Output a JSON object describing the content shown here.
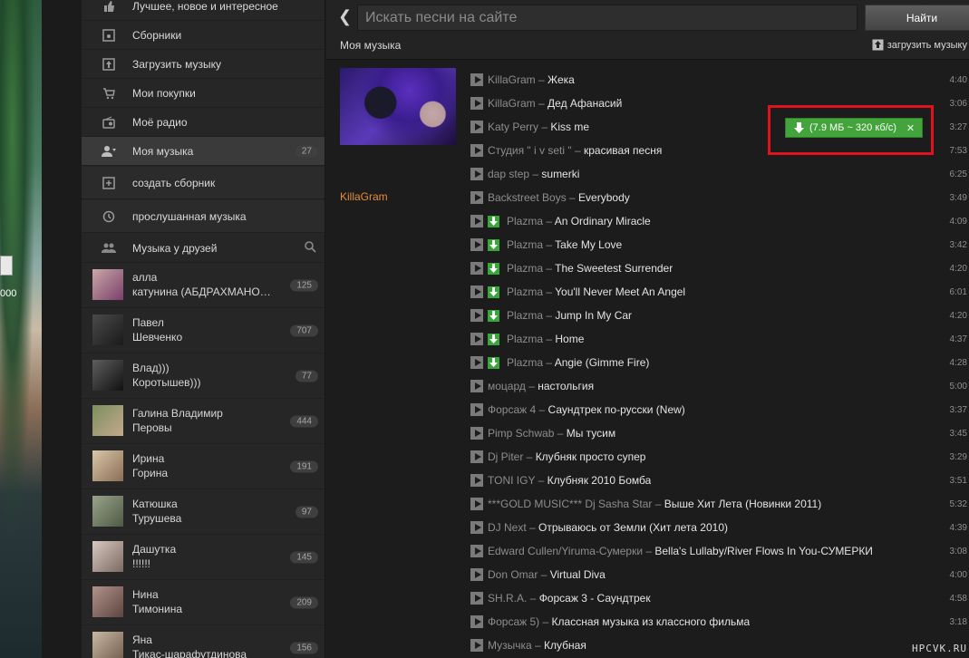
{
  "sidebar": {
    "nav": [
      {
        "label": "Лучшее, новое и интересное",
        "icon": "thumbs-up-icon"
      },
      {
        "label": "Сборники",
        "icon": "album-icon"
      },
      {
        "label": "Загрузить музыку",
        "icon": "upload-icon"
      },
      {
        "label": "Мои покупки",
        "icon": "cart-icon"
      },
      {
        "label": "Моё радио",
        "icon": "radio-icon"
      },
      {
        "label": "Моя музыка",
        "icon": "user-music-icon",
        "count": "27",
        "active": true
      },
      {
        "label": "создать сборник",
        "icon": "plus-square-icon"
      },
      {
        "label": "прослушанная музыка",
        "icon": "history-icon"
      },
      {
        "label": "Музыка у друзей",
        "icon": "friends-icon"
      }
    ],
    "friends": [
      {
        "first": "алла",
        "last": "катунина (АБДРАХМАНОВА)",
        "count": "125"
      },
      {
        "first": "Павел",
        "last": "Шевченко",
        "count": "707"
      },
      {
        "first": "Влад)))",
        "last": "Коротышев)))",
        "count": "77"
      },
      {
        "first": "Галина Владимир",
        "last": "Перовы",
        "count": "444"
      },
      {
        "first": "Ирина",
        "last": "Горина",
        "count": "191"
      },
      {
        "first": "Катюшка",
        "last": "Турушева",
        "count": "97"
      },
      {
        "first": "Дашутка",
        "last": "!!!!!!",
        "count": "145"
      },
      {
        "first": "Нина",
        "last": "Тимонина",
        "count": "209"
      },
      {
        "first": "Яна",
        "last": "Тикас-шарафутдинова",
        "count": "156"
      }
    ]
  },
  "desktop": {
    "text": "000"
  },
  "header": {
    "search_placeholder": "Искать песни на сайте",
    "find_label": "Найти",
    "title": "Моя музыка",
    "upload_label": "загрузить музыку"
  },
  "album": {
    "artist": "KillaGram"
  },
  "download_badge": {
    "text": "(7.9 МБ ~ 320 кб/с)",
    "close": "✕"
  },
  "tracks": [
    {
      "artist": "KillaGram",
      "title": "Жека",
      "duration": "4:40",
      "dl": false
    },
    {
      "artist": "KillaGram",
      "title": "Дед Афанасий",
      "duration": "3:06",
      "dl": false
    },
    {
      "artist": "Katy Perry",
      "title": "Kiss me",
      "duration": "3:27",
      "dl": false
    },
    {
      "artist": "Студия \" i v seti \"",
      "title": "красивая песня",
      "duration": "7:53",
      "dl": false
    },
    {
      "artist": "dap step",
      "title": "sumerki",
      "duration": "6:25",
      "dl": false
    },
    {
      "artist": "Backstreet Boys",
      "title": "Everybody",
      "duration": "3:49",
      "dl": false
    },
    {
      "artist": "Plazma",
      "title": "An Ordinary Miracle",
      "duration": "4:09",
      "dl": true
    },
    {
      "artist": "Plazma",
      "title": "Take My Love",
      "duration": "3:42",
      "dl": true
    },
    {
      "artist": "Plazma",
      "title": "The Sweetest Surrender",
      "duration": "4:20",
      "dl": true
    },
    {
      "artist": "Plazma",
      "title": "You'll Never Meet An Angel",
      "duration": "6:01",
      "dl": true
    },
    {
      "artist": "Plazma",
      "title": "Jump In My Car",
      "duration": "4:20",
      "dl": true
    },
    {
      "artist": "Plazma",
      "title": "Home",
      "duration": "4:37",
      "dl": true
    },
    {
      "artist": "Plazma",
      "title": "Angie (Gimme Fire)",
      "duration": "4:28",
      "dl": true
    },
    {
      "artist": "моцард",
      "title": "настольгия",
      "duration": "5:00",
      "dl": false
    },
    {
      "artist": "Форсаж 4",
      "title": "Саундтрек по-русски (New)",
      "duration": "3:37",
      "dl": false
    },
    {
      "artist": "Pimp Schwab",
      "title": "Мы тусим",
      "duration": "3:45",
      "dl": false
    },
    {
      "artist": "Dj Piter",
      "title": "Клубняк просто супер",
      "duration": "3:29",
      "dl": false
    },
    {
      "artist": "TONI IGY",
      "title": "Клубняк 2010 Бомба",
      "duration": "3:51",
      "dl": false
    },
    {
      "artist": "***GOLD MUSIC*** Dj Sasha Star",
      "title": "Выше Хит Лета (Новинки 2011)",
      "duration": "5:32",
      "dl": false
    },
    {
      "artist": "DJ Next",
      "title": "Отрываюсь от Земли (Хит лета 2010)",
      "duration": "4:39",
      "dl": false
    },
    {
      "artist": "Edward Cullen/Yiruma-Сумерки",
      "title": "Bella's Lullaby/River Flows In You-СУМЕРКИ",
      "duration": "3:08",
      "dl": false
    },
    {
      "artist": "Don Omar",
      "title": "Virtual Diva",
      "duration": "4:00",
      "dl": false
    },
    {
      "artist": "SH.R.A.",
      "title": "Форсаж 3 - Саундтрек",
      "duration": "4:58",
      "dl": false
    },
    {
      "artist": "Форсаж 5)",
      "title": "Классная музыка из классного фильма",
      "duration": "3:18",
      "dl": false
    },
    {
      "artist": "Музычка",
      "title": "Клубная",
      "duration": "",
      "dl": false
    }
  ],
  "watermark": "HPCVK.RU",
  "colors": {
    "accent_download": "#44a43c",
    "highlight": "#e0121e",
    "artist_link": "#e38c3a"
  }
}
